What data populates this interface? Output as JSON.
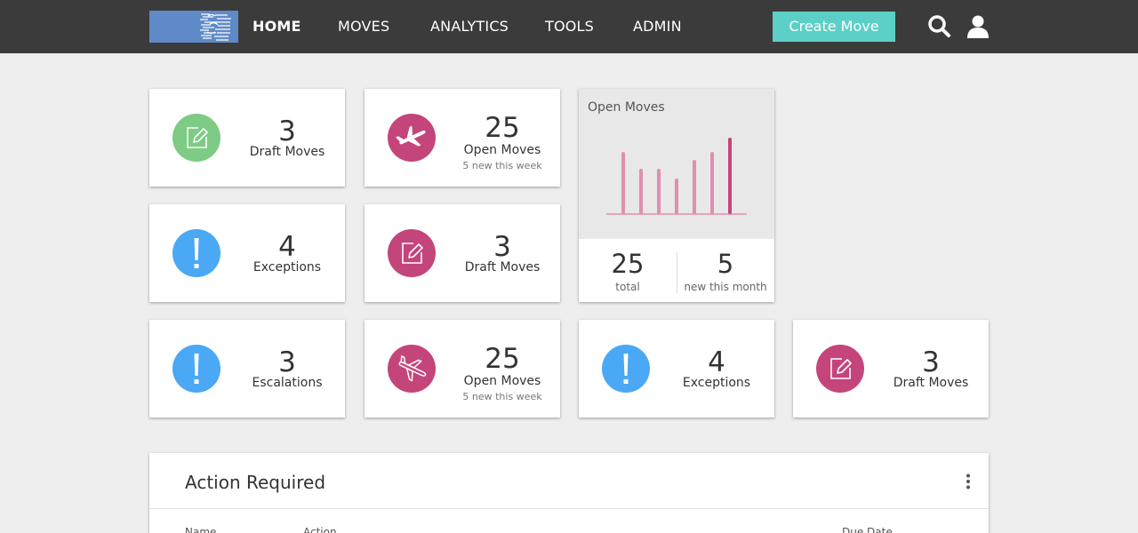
{
  "nav": {
    "items": [
      {
        "label": "HOME",
        "active": true
      },
      {
        "label": "MOVES",
        "active": false
      },
      {
        "label": "ANALYTICS",
        "active": false
      },
      {
        "label": "TOOLS",
        "active": false
      },
      {
        "label": "ADMIN",
        "active": false
      }
    ],
    "create_label": "Create Move",
    "icons": [
      "search-icon",
      "user-icon"
    ]
  },
  "cards": [
    {
      "number": "3",
      "label": "Draft Moves",
      "sub": "",
      "icon": "edit-icon",
      "color": "#7dcb84"
    },
    {
      "number": "25",
      "label": "Open Moves",
      "sub": "5 new this week",
      "icon": "airplane-icon",
      "color": "#c4457a"
    },
    {
      "number": "4",
      "label": "Exceptions",
      "sub": "",
      "icon": "exclamation-icon",
      "color": "#4aa8f5"
    },
    {
      "number": "3",
      "label": "Draft Moves",
      "sub": "",
      "icon": "edit-icon",
      "color": "#c4457a"
    },
    {
      "number": "3",
      "label": "Escalations",
      "sub": "",
      "icon": "exclamation-icon",
      "color": "#4aa8f5"
    },
    {
      "number": "25",
      "label": "Open Moves",
      "sub": "5 new this week",
      "icon": "airplane-icon",
      "color": "#c4457a"
    },
    {
      "number": "4",
      "label": "Exceptions",
      "sub": "",
      "icon": "exclamation-icon",
      "color": "#4aa8f5"
    },
    {
      "number": "3",
      "label": "Draft Moves",
      "sub": "",
      "icon": "edit-icon",
      "color": "#c4457a"
    }
  ],
  "chart_card": {
    "title": "Open Moves",
    "stats": [
      {
        "value": "25",
        "label": "total"
      },
      {
        "value": "5",
        "label": "new this month"
      }
    ]
  },
  "chart_data": {
    "type": "bar",
    "title": "Open Moves",
    "values": [
      70,
      51,
      51,
      40,
      61,
      70,
      86
    ],
    "ylim": [
      0,
      100
    ],
    "highlight_index": 6,
    "bar_color": "#e08fb0",
    "highlight_color": "#c4457a"
  },
  "panel": {
    "title": "Action Required",
    "columns": [
      "Name",
      "Action",
      "Due Date"
    ]
  },
  "colors": {
    "nav_bg": "#3b3b3b",
    "accent": "#5cd0c6",
    "green": "#7dcb84",
    "magenta": "#c4457a",
    "blue": "#4aa8f5"
  }
}
